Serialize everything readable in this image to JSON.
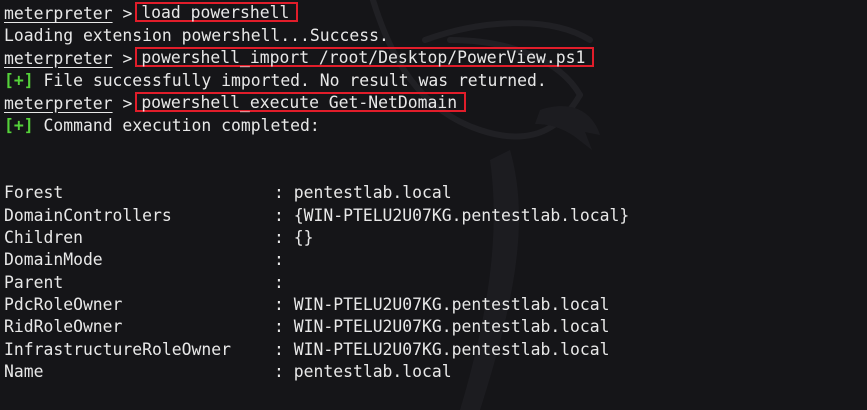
{
  "prompt": "meterpreter",
  "prompt_symbol": ">",
  "status_marker": "[+]",
  "colors": {
    "background": "#151518",
    "text": "#e8e8e8",
    "success": "#55d23a",
    "highlight_box": "#e11d2a"
  },
  "session": [
    {
      "command": "load powershell"
    },
    {
      "output": "Loading extension powershell...Success."
    },
    {
      "command": "powershell_import /root/Desktop/PowerView.ps1"
    },
    {
      "status_output": "File successfully imported. No result was returned."
    },
    {
      "command": "powershell_execute Get-NetDomain"
    },
    {
      "status_output": "Command execution completed:"
    }
  ],
  "domain_info": [
    {
      "key": "Forest",
      "value": "pentestlab.local"
    },
    {
      "key": "DomainControllers",
      "value": "{WIN-PTELU2U07KG.pentestlab.local}"
    },
    {
      "key": "Children",
      "value": "{}"
    },
    {
      "key": "DomainMode",
      "value": ""
    },
    {
      "key": "Parent",
      "value": ""
    },
    {
      "key": "PdcRoleOwner",
      "value": "WIN-PTELU2U07KG.pentestlab.local"
    },
    {
      "key": "RidRoleOwner",
      "value": "WIN-PTELU2U07KG.pentestlab.local"
    },
    {
      "key": "InfrastructureRoleOwner",
      "value": "WIN-PTELU2U07KG.pentestlab.local"
    },
    {
      "key": "Name",
      "value": "pentestlab.local"
    }
  ],
  "separator": ":",
  "watermark_icon": "kali-dragon-icon"
}
